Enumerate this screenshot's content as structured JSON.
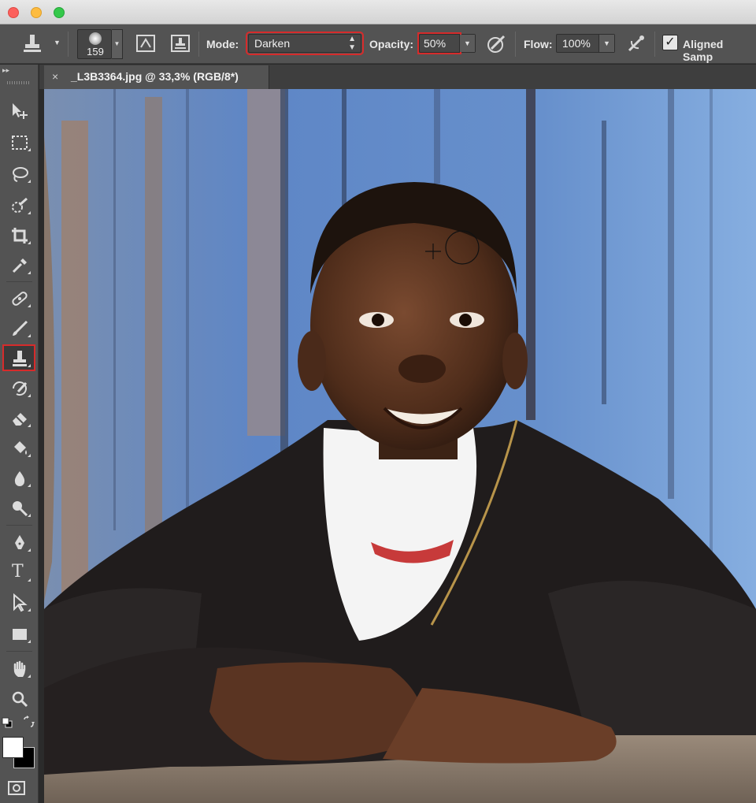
{
  "options_bar": {
    "tool_icon": "clone-stamp-icon",
    "brush_size": "159",
    "mode_label": "Mode:",
    "mode_value": "Darken",
    "opacity_label": "Opacity:",
    "opacity_value": "50%",
    "flow_label": "Flow:",
    "flow_value": "100%",
    "aligned_checked": true,
    "aligned_label": "Aligned Samp"
  },
  "document": {
    "tab_title": "_L3B3364.jpg @ 33,3% (RGB/8*)",
    "close_glyph": "×"
  },
  "toolbox": {
    "active_tool": "clone-stamp-tool",
    "tools": [
      "move-tool",
      "marquee-tool",
      "lasso-tool",
      "quick-selection-tool",
      "crop-tool",
      "eyedropper-tool",
      "spot-healing-tool",
      "brush-tool",
      "clone-stamp-tool",
      "history-brush-tool",
      "eraser-tool",
      "paint-bucket-tool",
      "blur-tool",
      "dodge-tool",
      "pen-tool",
      "type-tool",
      "path-selection-tool",
      "rectangle-tool",
      "hand-tool",
      "zoom-tool"
    ],
    "type_glyph": "T"
  },
  "colors": {
    "highlight": "#d62b2b",
    "foreground": "#ffffff",
    "background": "#000000"
  }
}
